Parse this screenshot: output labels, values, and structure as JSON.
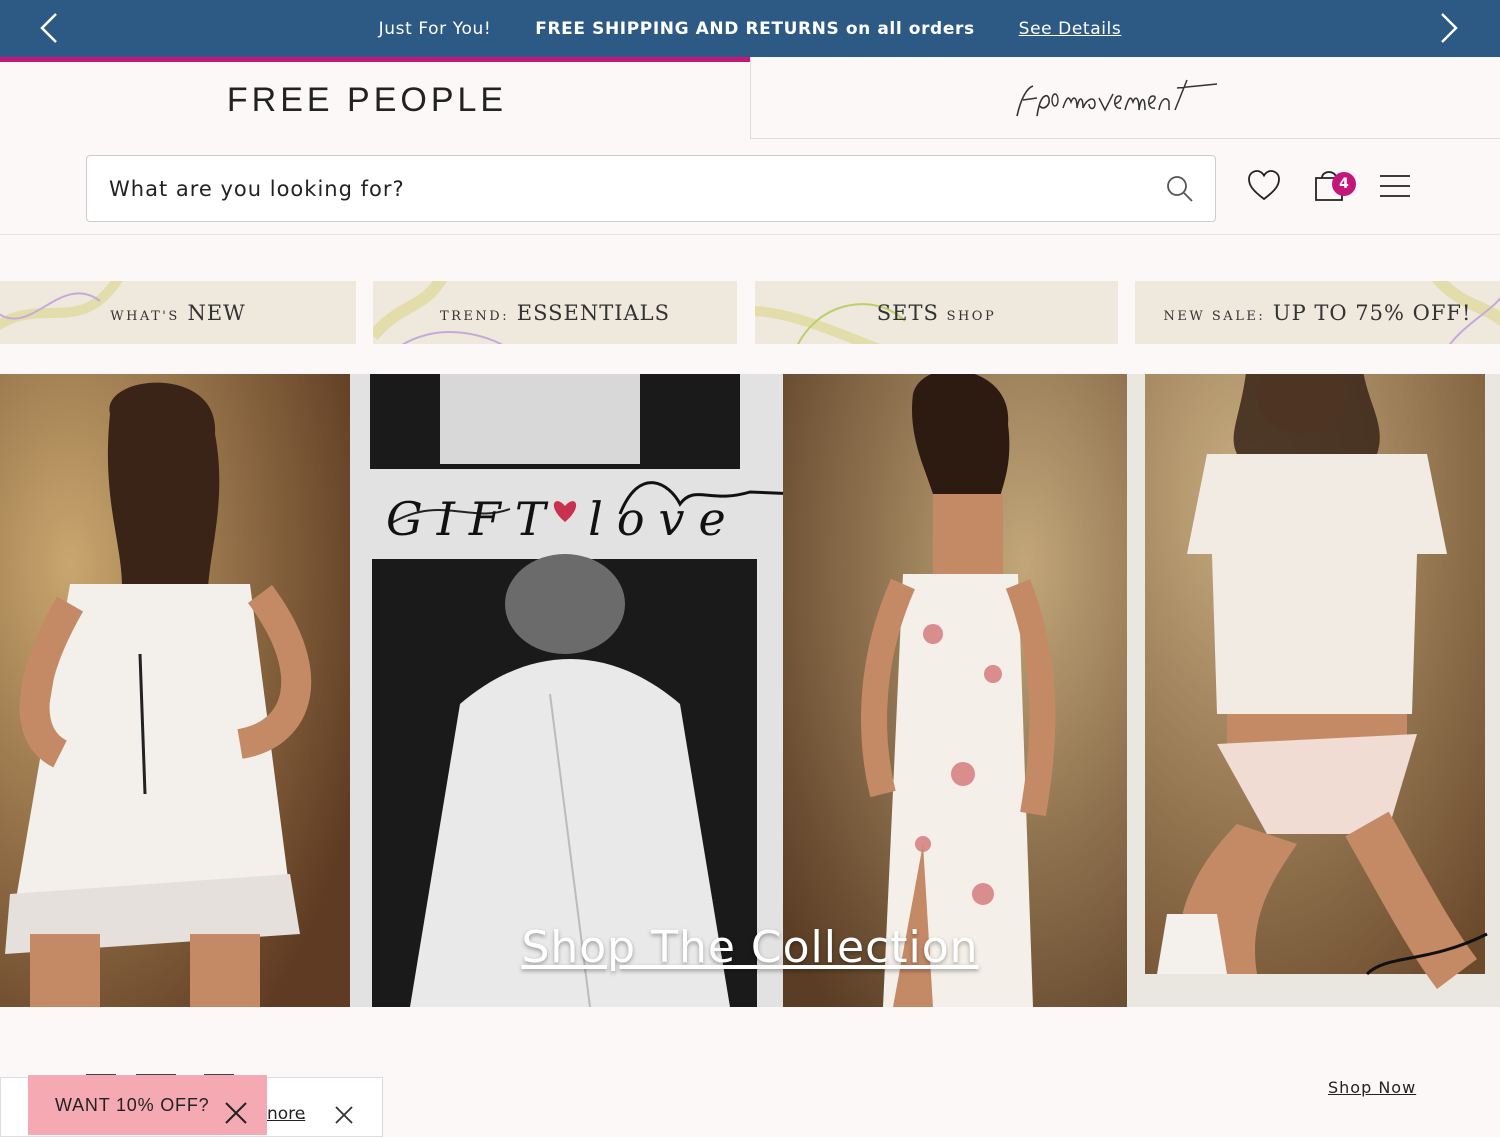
{
  "promo": {
    "tagline": "Just For You!",
    "message": "FREE SHIPPING AND RETURNS on all orders",
    "details_link": "See Details"
  },
  "brands": {
    "primary": "FREE PEOPLE",
    "secondary": "fp movement"
  },
  "search": {
    "placeholder": "What are you looking for?"
  },
  "header": {
    "cart_count": "4"
  },
  "categories": [
    {
      "small": "What's",
      "large": "NEW"
    },
    {
      "small": "Trend:",
      "large": "ESSENTIALS"
    },
    {
      "large": "SETS",
      "small": "Shop"
    },
    {
      "small": "New Sale:",
      "large": "UP TO 75% OFF!"
    }
  ],
  "hero": {
    "cta": "Shop The Collection",
    "overlay_script": "GIFT love"
  },
  "section": {
    "shop_now": "Shop Now"
  },
  "cookie": {
    "more_link": "nore",
    "more_tail": "."
  },
  "offer": {
    "label": "WANT 10% OFF?"
  },
  "colors": {
    "promo_bar": "#2d5a85",
    "accent": "#c4177a",
    "offer_bg": "#f5aab3"
  }
}
